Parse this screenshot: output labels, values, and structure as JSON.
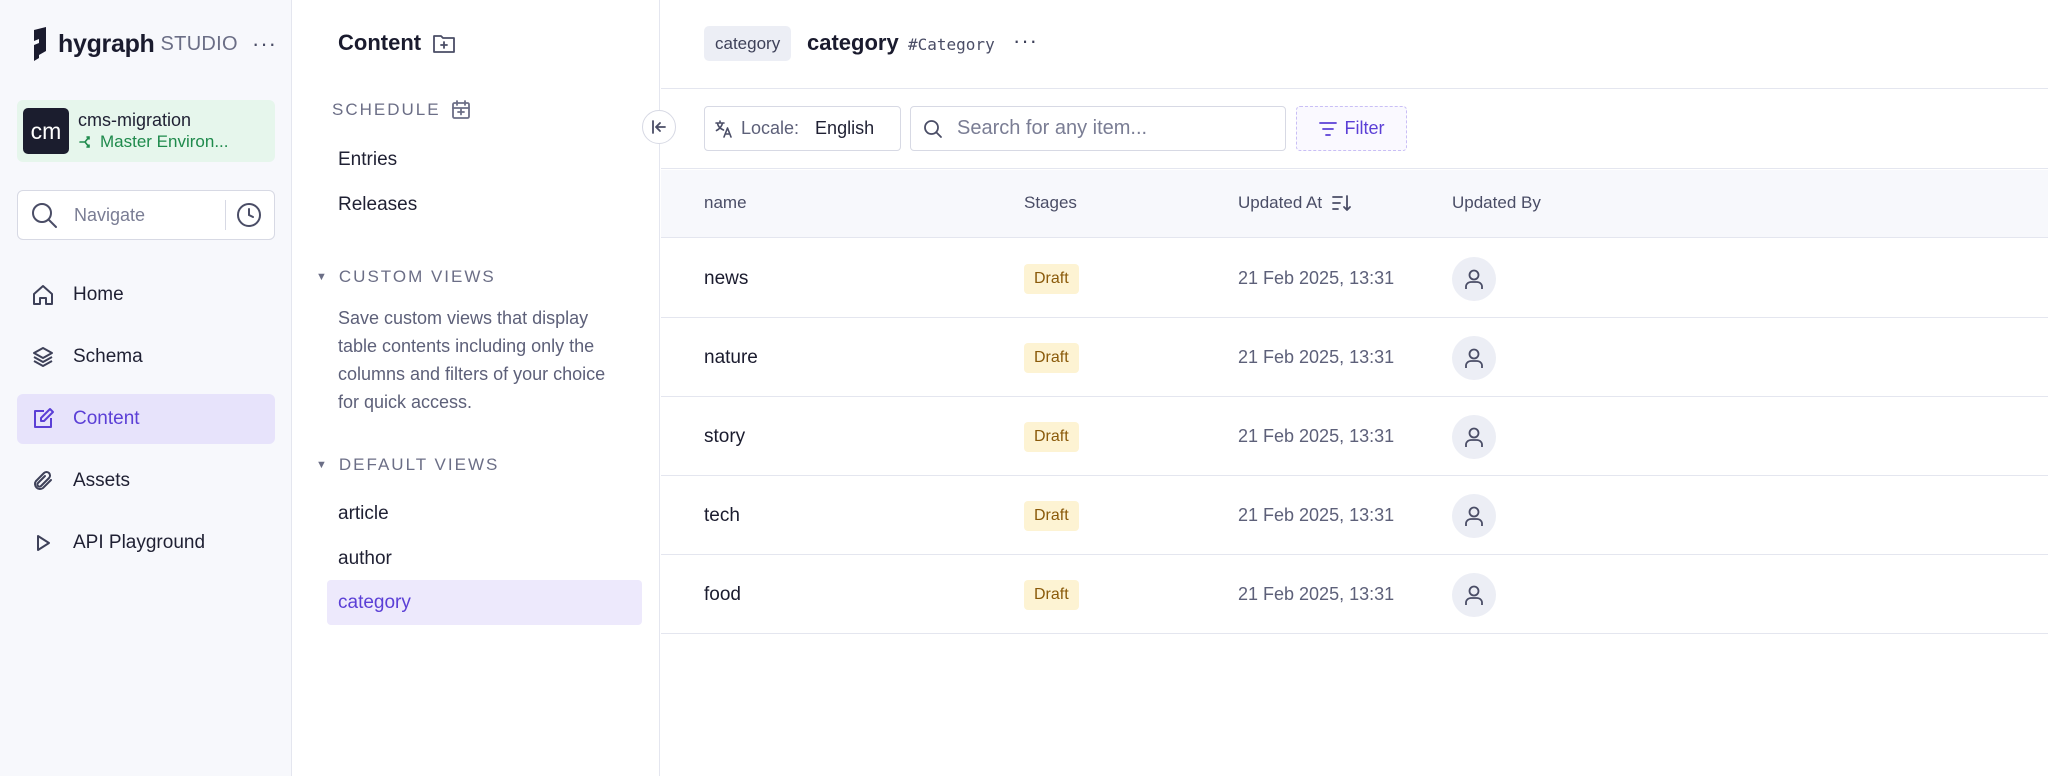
{
  "brand": {
    "name": "hygraph",
    "suffix": "STUDIO",
    "more": "···"
  },
  "project": {
    "avatar": "cm",
    "name": "cms-migration",
    "environment": "Master Environ..."
  },
  "navigate": {
    "placeholder": "Navigate"
  },
  "nav": {
    "items": [
      {
        "label": "Home",
        "icon": "home-icon"
      },
      {
        "label": "Schema",
        "icon": "layers-icon"
      },
      {
        "label": "Content",
        "icon": "edit-icon",
        "active": true
      },
      {
        "label": "Assets",
        "icon": "paperclip-icon"
      },
      {
        "label": "API Playground",
        "icon": "play-icon"
      }
    ]
  },
  "content_sidebar": {
    "title": "Content",
    "schedule": {
      "heading": "SCHEDULE",
      "items": [
        "Entries",
        "Releases"
      ]
    },
    "custom_views": {
      "heading": "CUSTOM VIEWS",
      "description": "Save custom views that display table contents including only the columns and filters of your choice for quick access."
    },
    "default_views": {
      "heading": "DEFAULT VIEWS",
      "items": [
        "article",
        "author",
        "category"
      ],
      "active": "category"
    }
  },
  "header": {
    "chip": "category",
    "title": "category",
    "api_id": "#Category",
    "more": "···"
  },
  "toolbar": {
    "locale_label": "Locale:",
    "locale_value": "English",
    "search_placeholder": "Search for any item...",
    "filter_label": "Filter"
  },
  "table": {
    "columns": [
      "name",
      "Stages",
      "Updated At",
      "Updated By"
    ],
    "rows": [
      {
        "name": "news",
        "stage": "Draft",
        "updated_at": "21 Feb 2025, 13:31"
      },
      {
        "name": "nature",
        "stage": "Draft",
        "updated_at": "21 Feb 2025, 13:31"
      },
      {
        "name": "story",
        "stage": "Draft",
        "updated_at": "21 Feb 2025, 13:31"
      },
      {
        "name": "tech",
        "stage": "Draft",
        "updated_at": "21 Feb 2025, 13:31"
      },
      {
        "name": "food",
        "stage": "Draft",
        "updated_at": "21 Feb 2025, 13:31"
      }
    ]
  },
  "colors": {
    "accent": "#5b3fd6",
    "draft_bg": "#fdf3d3",
    "draft_text": "#8a5a0a",
    "env_green": "#1f8a4c"
  }
}
